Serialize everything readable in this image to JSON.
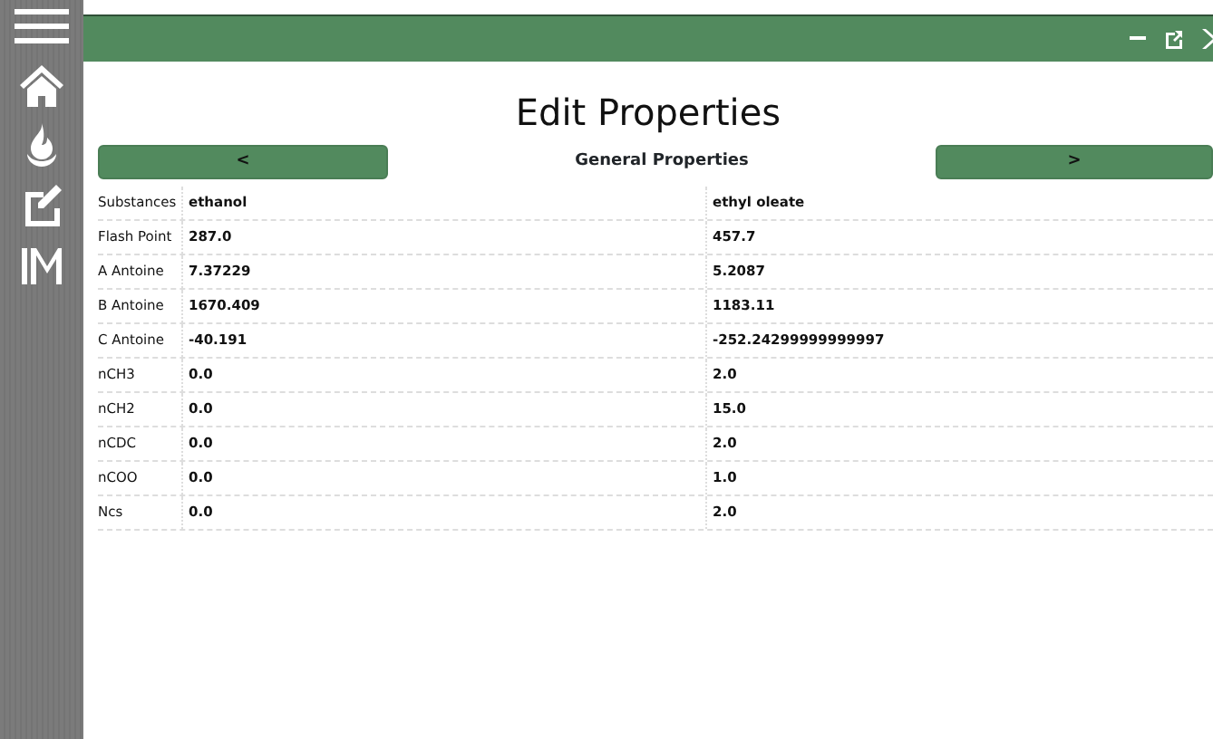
{
  "title": "Edit Properties",
  "nav": {
    "prev": "<",
    "section": "General Properties",
    "next": ">"
  },
  "rows": [
    {
      "label": "Substances",
      "values": [
        "ethanol",
        "ethyl oleate"
      ]
    },
    {
      "label": "Flash Point",
      "values": [
        "287.0",
        "457.7"
      ]
    },
    {
      "label": "A Antoine",
      "values": [
        "7.37229",
        "5.2087"
      ]
    },
    {
      "label": "B Antoine",
      "values": [
        "1670.409",
        "1183.11"
      ]
    },
    {
      "label": "C Antoine",
      "values": [
        "-40.191",
        "-252.24299999999997"
      ]
    },
    {
      "label": "nCH3",
      "values": [
        "0.0",
        "2.0"
      ]
    },
    {
      "label": "nCH2",
      "values": [
        "0.0",
        "15.0"
      ]
    },
    {
      "label": "nCDC",
      "values": [
        "0.0",
        "2.0"
      ]
    },
    {
      "label": "nCOO",
      "values": [
        "0.0",
        "1.0"
      ]
    },
    {
      "label": "Ncs",
      "values": [
        "0.0",
        "2.0"
      ]
    }
  ]
}
